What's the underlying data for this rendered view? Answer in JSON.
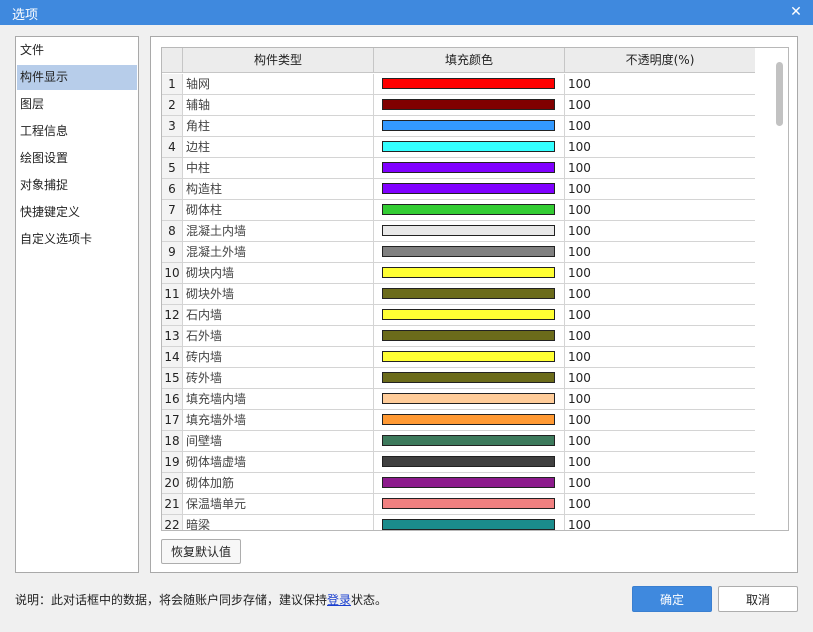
{
  "window": {
    "title": "选项"
  },
  "sidebar": {
    "items": [
      {
        "label": "文件"
      },
      {
        "label": "构件显示",
        "selected": true
      },
      {
        "label": "图层"
      },
      {
        "label": "工程信息"
      },
      {
        "label": "绘图设置"
      },
      {
        "label": "对象捕捉"
      },
      {
        "label": "快捷键定义"
      },
      {
        "label": "自定义选项卡"
      }
    ]
  },
  "table": {
    "headers": [
      "构件类型",
      "填充颜色",
      "不透明度(%)"
    ],
    "rows": [
      {
        "num": "1",
        "name": "轴网",
        "color": "#ff0000",
        "opacity": "100"
      },
      {
        "num": "2",
        "name": "辅轴",
        "color": "#800000",
        "opacity": "100"
      },
      {
        "num": "3",
        "name": "角柱",
        "color": "#3399ff",
        "opacity": "100"
      },
      {
        "num": "4",
        "name": "边柱",
        "color": "#33ffff",
        "opacity": "100"
      },
      {
        "num": "5",
        "name": "中柱",
        "color": "#8000ff",
        "opacity": "100"
      },
      {
        "num": "6",
        "name": "构造柱",
        "color": "#8000ff",
        "opacity": "100"
      },
      {
        "num": "7",
        "name": "砌体柱",
        "color": "#33cc33",
        "opacity": "100"
      },
      {
        "num": "8",
        "name": "混凝土内墙",
        "color": "#e8e8e8",
        "opacity": "100"
      },
      {
        "num": "9",
        "name": "混凝土外墙",
        "color": "#808080",
        "opacity": "100"
      },
      {
        "num": "10",
        "name": "砌块内墙",
        "color": "#ffff33",
        "opacity": "100"
      },
      {
        "num": "11",
        "name": "砌块外墙",
        "color": "#6b6b1a",
        "opacity": "100"
      },
      {
        "num": "12",
        "name": "石内墙",
        "color": "#ffff33",
        "opacity": "100"
      },
      {
        "num": "13",
        "name": "石外墙",
        "color": "#6b6b1a",
        "opacity": "100"
      },
      {
        "num": "14",
        "name": "砖内墙",
        "color": "#ffff33",
        "opacity": "100"
      },
      {
        "num": "15",
        "name": "砖外墙",
        "color": "#6b6b1a",
        "opacity": "100"
      },
      {
        "num": "16",
        "name": "填充墙内墙",
        "color": "#ffcc99",
        "opacity": "100"
      },
      {
        "num": "17",
        "name": "填充墙外墙",
        "color": "#ff9933",
        "opacity": "100"
      },
      {
        "num": "18",
        "name": "间壁墙",
        "color": "#3d7a5c",
        "opacity": "100"
      },
      {
        "num": "19",
        "name": "砌体墙虚墙",
        "color": "#404040",
        "opacity": "100"
      },
      {
        "num": "20",
        "name": "砌体加筋",
        "color": "#8c1a8c",
        "opacity": "100"
      },
      {
        "num": "21",
        "name": "保温墙单元",
        "color": "#f08080",
        "opacity": "100"
      },
      {
        "num": "22",
        "name": "暗梁",
        "color": "#1a8c8c",
        "opacity": "100"
      }
    ]
  },
  "buttons": {
    "restore": "恢复默认值",
    "ok": "确定",
    "cancel": "取消"
  },
  "note": {
    "prefix": "说明：此对话框中的数据，将会随账户同步存储，建议保持",
    "link": "登录",
    "suffix": "状态。"
  },
  "colors": {
    "titlebar": "#3f89de",
    "selected": "#b7cdea",
    "link": "#1a3fcf"
  },
  "icons": {
    "close": "close-icon"
  }
}
